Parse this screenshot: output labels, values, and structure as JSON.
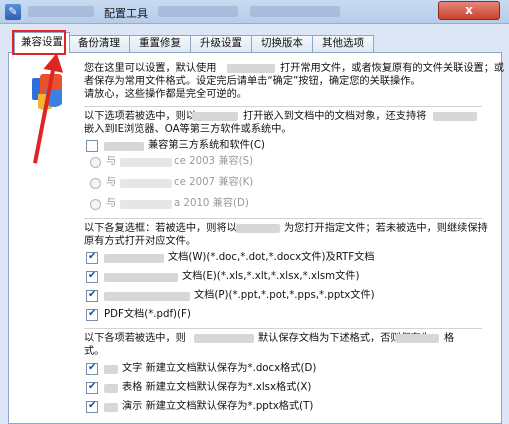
{
  "window": {
    "title": "配置工具",
    "close_label": "x"
  },
  "tabs": [
    "兼容设置",
    "备份清理",
    "重置修复",
    "升级设置",
    "切换版本",
    "其他选项"
  ],
  "intro": {
    "line1a": "您在这里可以设置，默认使用",
    "line1b": "打开常用文件，或者恢复原有的文件关联设置；或",
    "line2": "者保存为常用文件格式。设定完后请单击“确定”按钮，确定您的关联操作。",
    "line3": "请放心，这些操作都是完全可逆的。"
  },
  "embed": {
    "line1a": "以下选项若被选中，则以",
    "line1b": "打开嵌入到文档中的文档对象，还支持将",
    "line2": "嵌入到IE浏览器、OA等第三方软件或系统中。",
    "third_party_label": "兼容第三方系统和软件(C)",
    "third_party_checked": false,
    "radio_2003": "与",
    "radio_2003_suffix": "ce 2003 兼容(S)",
    "radio_2007": "与",
    "radio_2007_suffix": "ce 2007 兼容(K)",
    "radio_2010": "与",
    "radio_2010_suffix": "a 2010 兼容(D)"
  },
  "assoc": {
    "line1a": "以下各复选框：若被选中，则将以",
    "line1b": "为您打开指定文件；若未被选中，则继续保持",
    "line2": "原有方式打开对应文件。",
    "items": [
      {
        "label": "文档(W)(*.doc,*.dot,*.docx文件)及RTF文档",
        "checked": true
      },
      {
        "label": "文档(E)(*.xls,*.xlt,*.xlsx,*.xlsm文件)",
        "checked": true
      },
      {
        "label": "文档(P)(*.ppt,*.pot,*.pps,*.pptx文件)",
        "checked": true
      },
      {
        "label": "PDF文档(*.pdf)(F)",
        "checked": true
      }
    ]
  },
  "save": {
    "line1a": "以下各项若被选中，则",
    "line1b": "默认保存文档为下述格式，否则保存为",
    "line1c": "格",
    "line2": "式。",
    "items": [
      {
        "label": "文字  新建立文档默认保存为*.docx格式(D)",
        "checked": true
      },
      {
        "label": "表格  新建立文档默认保存为*.xlsx格式(X)",
        "checked": true
      },
      {
        "label": "演示  新建立文档默认保存为*.pptx格式(T)",
        "checked": true
      }
    ]
  }
}
